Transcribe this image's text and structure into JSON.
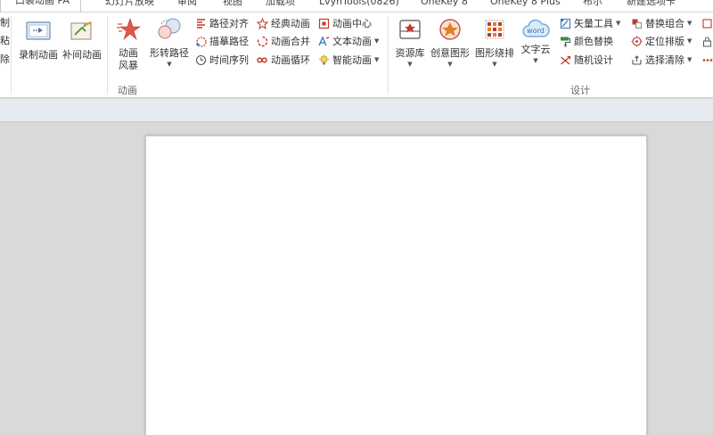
{
  "tabs": [
    {
      "label": "口袋动画 PA",
      "active": true
    },
    {
      "label": "幻灯片放映"
    },
    {
      "label": "审阅"
    },
    {
      "label": "视图"
    },
    {
      "label": "加载项"
    },
    {
      "label": "LvyhTools(0826)"
    },
    {
      "label": "OneKey 8"
    },
    {
      "label": "OneKey 8 Plus"
    },
    {
      "label": "布尔"
    },
    {
      "label": "新建选项卡"
    }
  ],
  "ribbon": {
    "left_cut": [
      "制",
      "粘",
      "除"
    ],
    "animation_group": {
      "label": "动画",
      "record": "录制动画",
      "tween": "补间动画",
      "storm_line1": "动画",
      "storm_line2": "风暴",
      "morph_path": "形转路径",
      "path_align": "路径对齐",
      "trace_path": "描摹路径",
      "time_sequence": "时间序列",
      "classic_anim": "经典动画",
      "anim_merge": "动画合并",
      "anim_loop": "动画循环",
      "anim_center": "动画中心",
      "text_anim": "文本动画",
      "smart_anim": "智能动画"
    },
    "design_group": {
      "label": "设计",
      "resource_lib": "资源库",
      "creative_shape": "创意图形",
      "shape_layout": "图形绕排",
      "word_cloud": "文字云",
      "word_icon_text": "word",
      "vector_tools": "矢量工具",
      "color_replace": "颜色替换",
      "random_design": "随机设计",
      "replace_combine": "替换组合",
      "position_layout": "定位排版",
      "select_clear": "选择清除"
    }
  },
  "colors": {
    "accent_red": "#c0392b",
    "accent_blue": "#2e75b6",
    "ribbon_bg": "#ffffff",
    "workspace_bg": "#d9d9d9"
  }
}
